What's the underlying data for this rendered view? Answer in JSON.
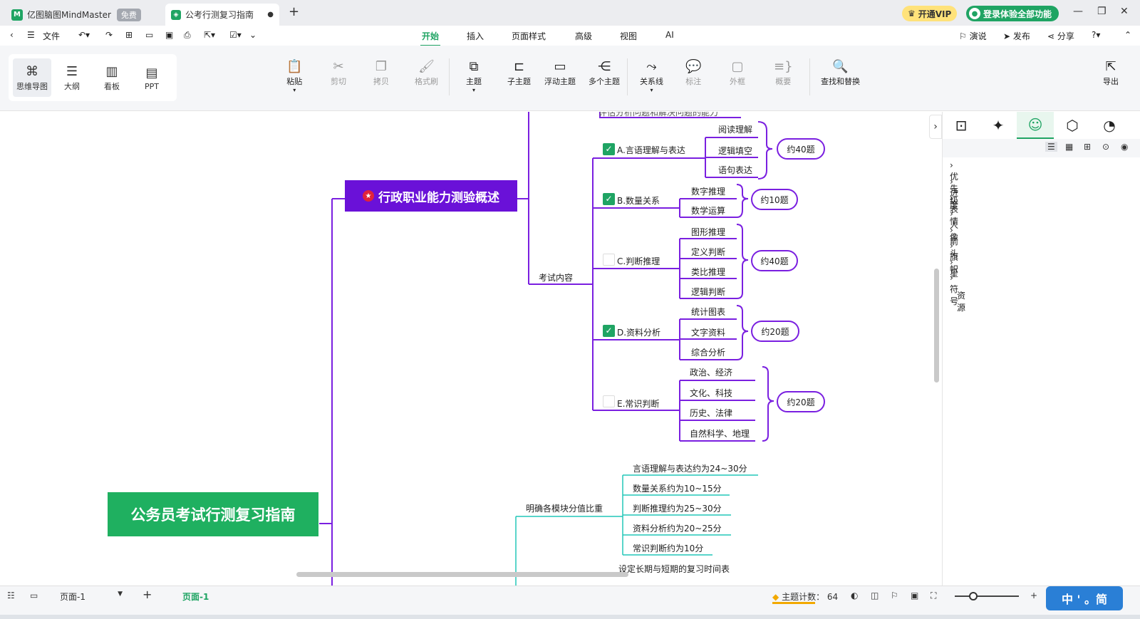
{
  "app": {
    "name": "亿图脑图MindMaster",
    "badge": "免费",
    "doc_tab": "公考行测复习指南",
    "vip_label": "开通VIP",
    "login_label": "登录体验全部功能"
  },
  "menubar": {
    "file": "文件",
    "tabs": [
      "开始",
      "插入",
      "页面样式",
      "高级",
      "视图",
      "AI"
    ],
    "right": [
      "演说",
      "发布",
      "分享"
    ]
  },
  "ribbon": {
    "views": [
      "思维导图",
      "大纲",
      "看板",
      "PPT"
    ],
    "buttons": [
      "粘贴",
      "剪切",
      "拷贝",
      "格式刷",
      "主题",
      "子主题",
      "浮动主题",
      "多个主题",
      "关系线",
      "标注",
      "外框",
      "概要",
      "查找和替换"
    ],
    "export": "导出"
  },
  "mindmap": {
    "root": "公务员考试行测复习指南",
    "branch1": "行政职业能力测验概述",
    "cut_text": "评估分析问题和解决问题的能力",
    "exam_content": "考试内容",
    "sections": [
      {
        "label": "A.言语理解与表达",
        "checked": true,
        "items": [
          "阅读理解",
          "逻辑填空",
          "语句表达"
        ],
        "count": "约40题"
      },
      {
        "label": "B.数量关系",
        "checked": true,
        "items": [
          "数字推理",
          "数学运算"
        ],
        "count": "约10题"
      },
      {
        "label": "C.判断推理",
        "checked": false,
        "items": [
          "图形推理",
          "定义判断",
          "类比推理",
          "逻辑判断"
        ],
        "count": "约40题"
      },
      {
        "label": "D.资料分析",
        "checked": true,
        "items": [
          "统计图表",
          "文字资料",
          "综合分析"
        ],
        "count": "约20题"
      },
      {
        "label": "E.常识判断",
        "checked": false,
        "items": [
          "政治、经济",
          "文化、科技",
          "历史、法律",
          "自然科学、地理"
        ],
        "count": "约20题"
      }
    ],
    "score_branch": "明确各模块分值比重",
    "scores": [
      "言语理解与表达约为24~30分",
      "数量关系约为10~15分",
      "判断推理约为25~30分",
      "资料分析约为20~25分",
      "常识判断约为10分"
    ],
    "schedule": "设定长期与短期的复习时间表"
  },
  "panel": {
    "items": [
      "优先级",
      "进度",
      "表情",
      "人像",
      "箭头",
      "旗帜",
      "星",
      "符号",
      "资源"
    ]
  },
  "status": {
    "page_select": "页面-1",
    "page_tab": "页面-1",
    "topic_count_label": "主题计数：",
    "topic_count": "64"
  },
  "colors": {
    "accent": "#1fa463",
    "purple": "#7a1fe0",
    "teal": "#22c7b8",
    "branch_fill": "#6a11d8"
  }
}
